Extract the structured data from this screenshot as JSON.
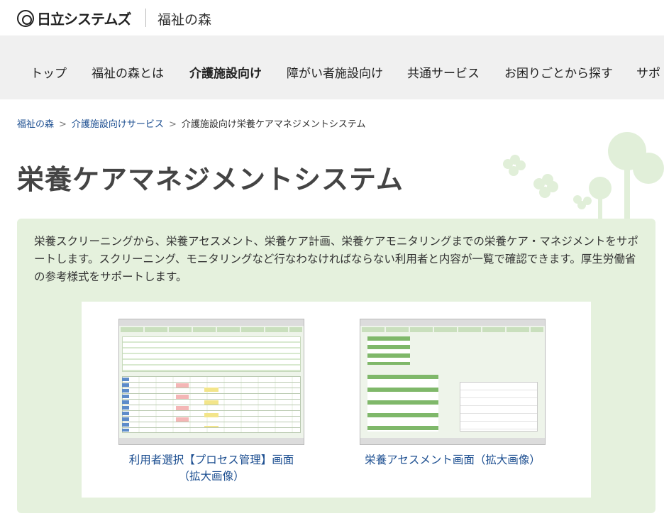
{
  "header": {
    "brand": "日立システムズ",
    "site_name": "福祉の森"
  },
  "nav": {
    "items": [
      {
        "label": "トップ"
      },
      {
        "label": "福祉の森とは"
      },
      {
        "label": "介護施設向け"
      },
      {
        "label": "障がい者施設向け"
      },
      {
        "label": "共通サービス"
      },
      {
        "label": "お困りごとから探す"
      },
      {
        "label": "サポ"
      }
    ]
  },
  "breadcrumb": {
    "items": [
      {
        "label": "福祉の森"
      },
      {
        "label": "介護施設向けサービス"
      },
      {
        "label": "介護施設向け栄養ケアマネジメントシステム"
      }
    ],
    "separator": ">"
  },
  "page": {
    "title": "栄養ケアマネジメントシステム",
    "description": "栄養スクリーニングから、栄養アセスメント、栄養ケア計画、栄養ケアモニタリングまでの栄養ケア・マネジメントをサポートします。スクリーニング、モニタリングなど行なわなければならない利用者と内容が一覧で確認できます。厚生労働省の参考様式をサポートします。"
  },
  "gallery": {
    "items": [
      {
        "caption_line1": "利用者選択【プロセス管理】画面",
        "caption_line2": "（拡大画像）"
      },
      {
        "caption_line1": "栄養アセスメント画面（拡大画像）",
        "caption_line2": ""
      }
    ]
  }
}
